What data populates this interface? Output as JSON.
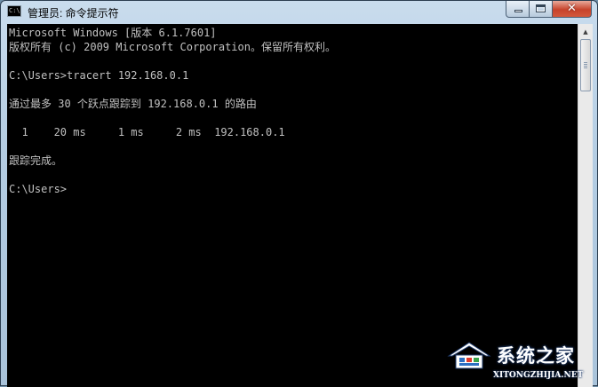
{
  "window": {
    "title": "管理员: 命令提示符",
    "icon": "cmd-icon",
    "icon_text": "C:\\."
  },
  "caption_buttons": {
    "minimize": "minimize-icon",
    "maximize": "maximize-icon",
    "close": "close-icon",
    "close_glyph": "✕"
  },
  "console": {
    "background": "#000000",
    "text_color": "#c0c0c0",
    "lines": [
      "Microsoft Windows [版本 6.1.7601]",
      "版权所有 (c) 2009 Microsoft Corporation。保留所有权利。",
      "C:\\Users>tracert 192.168.0.1",
      "通过最多 30 个跃点跟踪到 192.168.0.1 的路由",
      "  1    20 ms     1 ms     2 ms  192.168.0.1",
      "跟踪完成。",
      "C:\\Users>"
    ]
  },
  "scrollbar": {
    "up_arrow": "▲"
  },
  "watermark": {
    "title": "系统之家",
    "url": "XITONGZHIJIA.NET"
  }
}
